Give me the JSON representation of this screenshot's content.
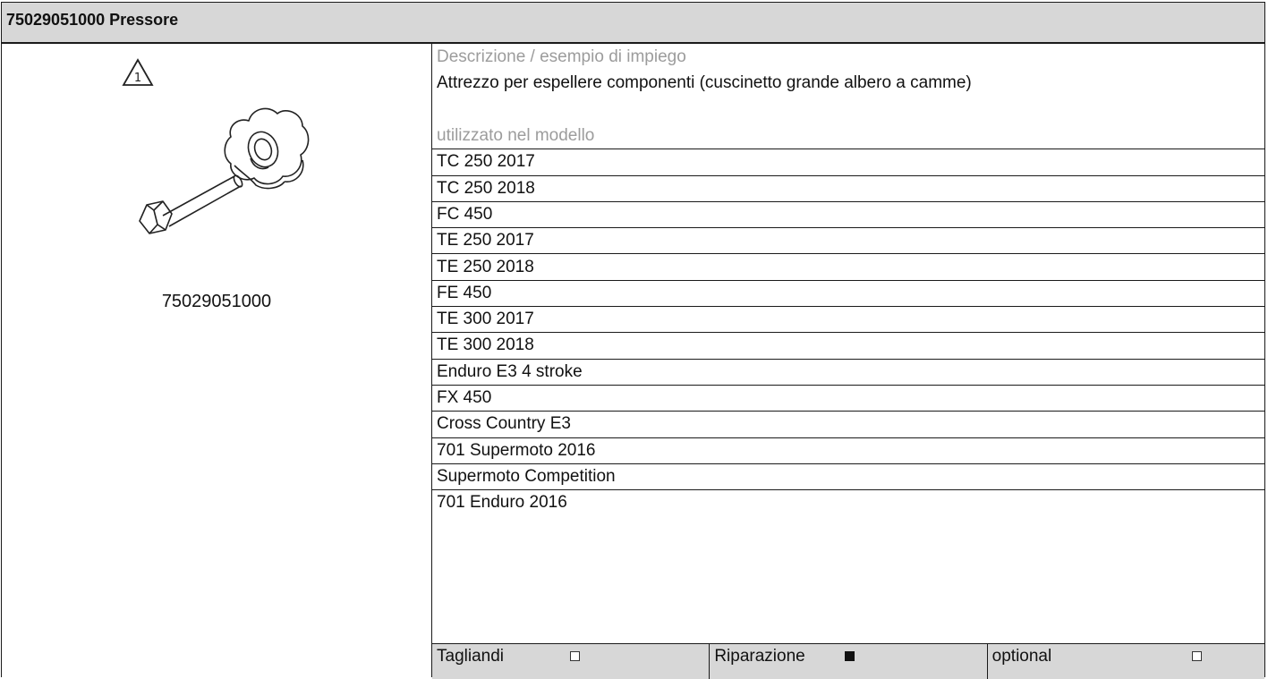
{
  "header": {
    "title": "75029051000 Pressore"
  },
  "image_panel": {
    "warning_symbol": "1",
    "part_number": "75029051000",
    "icons": [
      "warning-triangle-icon",
      "pressing-tool-image"
    ]
  },
  "details": {
    "description_heading": "Descrizione / esempio di impiego",
    "description": "Attrezzo per espellere componenti (cuscinetto grande albero a camme)",
    "models_heading": "utilizzato nel modello",
    "models": [
      "TC 250 2017",
      "TC 250 2018",
      "FC 450",
      "TE 250 2017",
      "TE 250 2018",
      "FE 450",
      "TE 300 2017",
      "TE 300 2018",
      "Enduro E3 4 stroke",
      "FX 450",
      "Cross Country E3",
      "701 Supermoto 2016",
      "Supermoto Competition",
      "701 Enduro 2016"
    ]
  },
  "footer": {
    "categories": [
      {
        "label": "Tagliandi",
        "checked": false
      },
      {
        "label": "Riparazione",
        "checked": true
      },
      {
        "label": "optional",
        "checked": false
      }
    ]
  },
  "colors": {
    "header_bg": "#d7d7d7",
    "secondary_text": "#9c9c9c",
    "border": "#1a1a1a"
  }
}
